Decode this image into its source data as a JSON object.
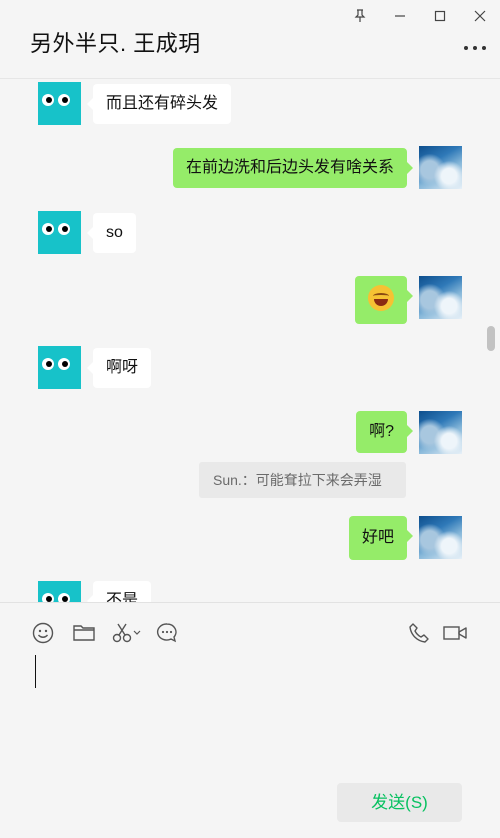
{
  "window": {
    "title": "另外半只. 王成玥",
    "controls": [
      "pin-icon",
      "minimize-icon",
      "maximize-icon",
      "close-icon"
    ],
    "more_icon": "more-icon"
  },
  "messages": [
    {
      "side": "left",
      "type": "text",
      "text": "而且还有碎头发"
    },
    {
      "side": "right",
      "type": "text",
      "text": "在前边洗和后边头发有啥关系"
    },
    {
      "side": "left",
      "type": "text",
      "text": "so"
    },
    {
      "side": "right",
      "type": "emoji",
      "icon": "laughing-crying-emoji-icon"
    },
    {
      "side": "left",
      "type": "text",
      "text": "啊呀"
    },
    {
      "side": "right",
      "type": "text",
      "text": "啊?"
    },
    {
      "side": "quote",
      "type": "quote",
      "text": "Sun.：可能耷拉下来会弄湿"
    },
    {
      "side": "right",
      "type": "text",
      "text": "好吧"
    },
    {
      "side": "left",
      "type": "text",
      "text": "不是"
    }
  ],
  "composer": {
    "toolbar": [
      "emoji-icon",
      "folder-icon",
      "scissors-icon",
      "chat-bubble-icon",
      "phone-icon",
      "video-icon"
    ],
    "send_label": "发送(S)"
  },
  "colors": {
    "self_bubble": "#95ec69",
    "other_bubble": "#ffffff",
    "send_text": "#07c160",
    "avatar_left": "#17c2c9"
  }
}
